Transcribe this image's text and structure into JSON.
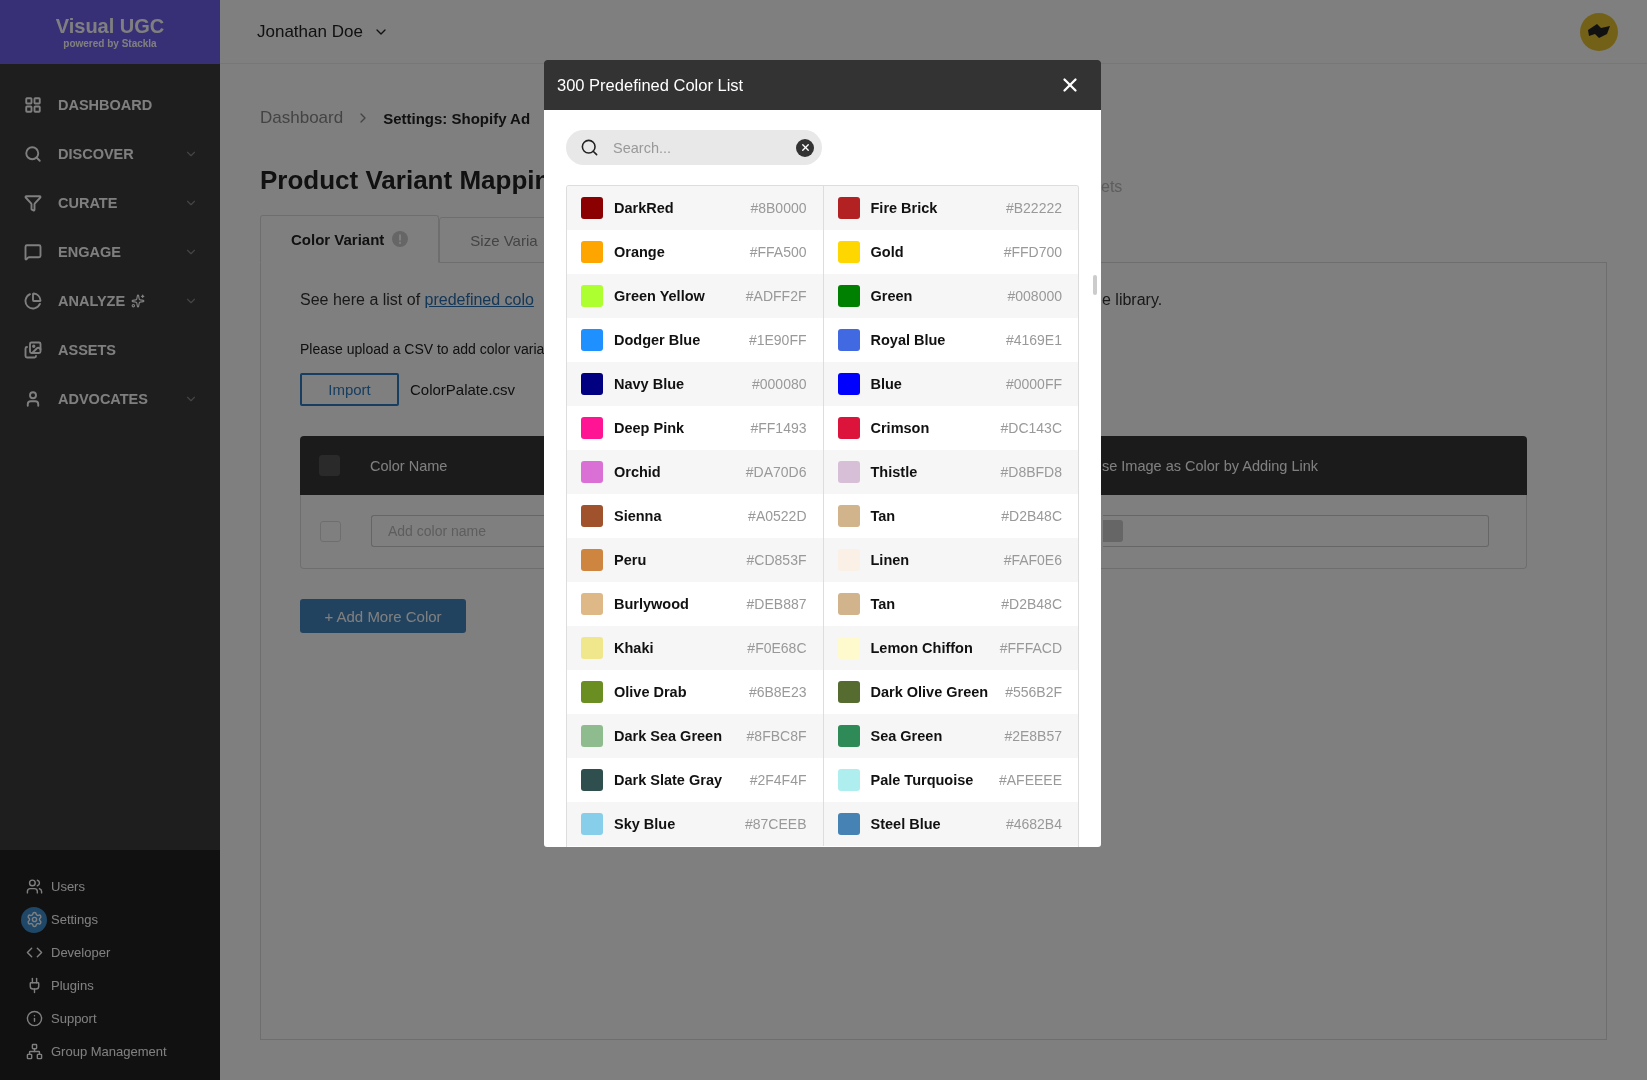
{
  "brand": {
    "title": "Visual UGC",
    "subtitle": "powered by Stackla"
  },
  "nav": [
    {
      "label": "DASHBOARD",
      "has_submenu": false
    },
    {
      "label": "DISCOVER",
      "has_submenu": true
    },
    {
      "label": "CURATE",
      "has_submenu": true
    },
    {
      "label": "ENGAGE",
      "has_submenu": true
    },
    {
      "label": "ANALYZE",
      "has_submenu": true
    },
    {
      "label": "ASSETS",
      "has_submenu": false
    },
    {
      "label": "ADVOCATES",
      "has_submenu": true
    }
  ],
  "bottom_nav": [
    {
      "label": "Users",
      "selected": false
    },
    {
      "label": "Settings",
      "selected": true
    },
    {
      "label": "Developer",
      "selected": false
    },
    {
      "label": "Plugins",
      "selected": false
    },
    {
      "label": "Support",
      "selected": false
    },
    {
      "label": "Group Management",
      "selected": false
    }
  ],
  "header": {
    "user": "Jonathan Doe"
  },
  "breadcrumb": [
    "Dashboard",
    "Settings: Shopify Ad"
  ],
  "page_title": "Product Variant Mappin",
  "title_aside": "ets",
  "tabs": [
    {
      "label": "Color Variant",
      "selected": true
    },
    {
      "label": "Size Varia",
      "selected": false
    }
  ],
  "intro": {
    "text": "See here a list of ",
    "link": "predefined colo",
    "tail": "e library."
  },
  "upload_note": "Please upload a CSV to add color varia",
  "import_button": "Import",
  "file_name": "ColorPalate.csv",
  "table": {
    "header_checked": false,
    "columns": [
      "Color Name",
      "se Image as Color by Adding Link"
    ],
    "rows": [
      {
        "checked": false,
        "placeholder": "Add color name"
      }
    ]
  },
  "add_button": "+ Add More Color",
  "modal": {
    "title": "300 Predefined Color List",
    "search_placeholder": "Search...",
    "rows": [
      [
        {
          "name": "DarkRed",
          "hex": "#8B0000",
          "color": "#8b0000"
        },
        {
          "name": "Fire Brick",
          "hex": "#B22222",
          "color": "#b22222"
        }
      ],
      [
        {
          "name": "Orange",
          "hex": "#FFA500",
          "color": "#ffa500"
        },
        {
          "name": "Gold",
          "hex": "#FFD700",
          "color": "#ffd700"
        }
      ],
      [
        {
          "name": "Green Yellow",
          "hex": "#ADFF2F",
          "color": "#adff2f"
        },
        {
          "name": "Green",
          "hex": "#008000",
          "color": "#008000"
        }
      ],
      [
        {
          "name": "Dodger Blue",
          "hex": "#1E90FF",
          "color": "#1e90ff"
        },
        {
          "name": "Royal Blue",
          "hex": "#4169E1",
          "color": "#4169e1"
        }
      ],
      [
        {
          "name": "Navy Blue",
          "hex": "#000080",
          "color": "#000080"
        },
        {
          "name": "Blue",
          "hex": "#0000FF",
          "color": "#0000ff"
        }
      ],
      [
        {
          "name": "Deep Pink",
          "hex": "#FF1493",
          "color": "#ff1493"
        },
        {
          "name": "Crimson",
          "hex": "#DC143C",
          "color": "#dc143c"
        }
      ],
      [
        {
          "name": "Orchid",
          "hex": "#DA70D6",
          "color": "#da70d6"
        },
        {
          "name": "Thistle",
          "hex": "#D8BFD8",
          "color": "#d8bfd8"
        }
      ],
      [
        {
          "name": "Sienna",
          "hex": "#A0522D",
          "color": "#a0522d"
        },
        {
          "name": "Tan",
          "hex": "#D2B48C",
          "color": "#d2b48c"
        }
      ],
      [
        {
          "name": "Peru",
          "hex": "#CD853F",
          "color": "#cd853f"
        },
        {
          "name": "Linen",
          "hex": "#FAF0E6",
          "color": "#faf0e6"
        }
      ],
      [
        {
          "name": "Burlywood",
          "hex": "#DEB887",
          "color": "#deb887"
        },
        {
          "name": "Tan",
          "hex": "#D2B48C",
          "color": "#d2b48c"
        }
      ],
      [
        {
          "name": "Khaki",
          "hex": "#F0E68C",
          "color": "#f0e68c"
        },
        {
          "name": "Lemon Chiffon",
          "hex": "#FFFACD",
          "color": "#fffacd"
        }
      ],
      [
        {
          "name": "Olive Drab",
          "hex": "#6B8E23",
          "color": "#6b8e23"
        },
        {
          "name": "Dark Olive Green",
          "hex": "#556B2F",
          "color": "#556b2f"
        }
      ],
      [
        {
          "name": "Dark Sea Green",
          "hex": "#8FBC8F",
          "color": "#8fbc8f"
        },
        {
          "name": "Sea Green",
          "hex": "#2E8B57",
          "color": "#2e8b57"
        }
      ],
      [
        {
          "name": "Dark Slate Gray",
          "hex": "#2F4F4F",
          "color": "#2f4f4f"
        },
        {
          "name": "Pale Turquoise",
          "hex": "#AFEEEE",
          "color": "#afeeee"
        }
      ],
      [
        {
          "name": "Sky Blue",
          "hex": "#87CEEB",
          "color": "#87ceeb"
        },
        {
          "name": "Steel Blue",
          "hex": "#4682B4",
          "color": "#4682b4"
        }
      ]
    ]
  }
}
